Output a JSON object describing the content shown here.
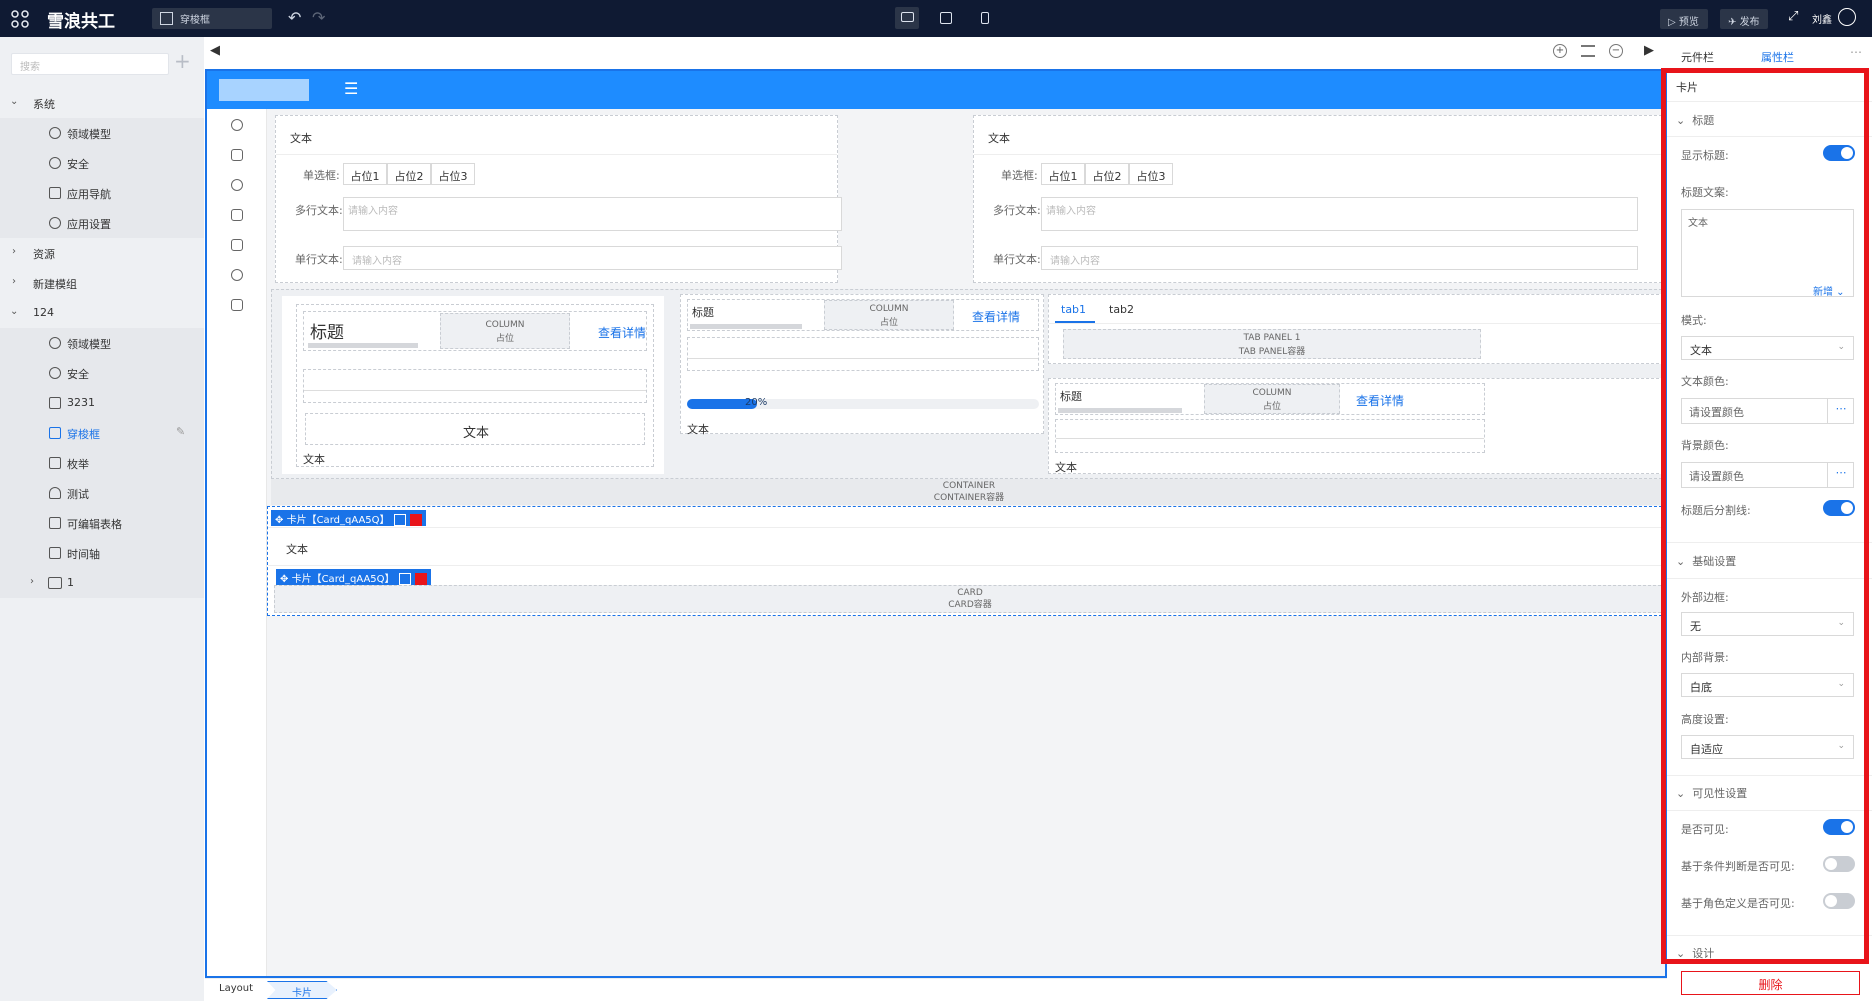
{
  "topbar": {
    "app_title": "雪浪共工",
    "page_selector": "穿梭框",
    "preview_label": "预览",
    "publish_label": "发布",
    "user_name": "刘鑫"
  },
  "sidebar": {
    "search_placeholder": "搜索",
    "groups": {
      "system": "系统",
      "system_domain": "领域模型",
      "system_security": "安全",
      "system_nav": "应用导航",
      "system_settings": "应用设置",
      "resources": "资源",
      "new_module": "新建模组",
      "g124": "124",
      "g124_domain": "领域模型",
      "g124_security": "安全",
      "g124_3231": "3231",
      "g124_shuttle": "穿梭框",
      "g124_enum": "枚举",
      "g124_test": "测试",
      "g124_table": "可编辑表格",
      "g124_timeline": "时间轴",
      "folder_1": "1"
    }
  },
  "canvas": {
    "form_left": {
      "title": "文本",
      "radio_label": "单选框:",
      "radio_options": [
        "占位1",
        "占位2",
        "占位3"
      ],
      "textarea_label": "多行文本:",
      "textarea_placeholder": "请输入内容",
      "input_label": "单行文本:",
      "input_placeholder": "请输入内容"
    },
    "form_right": {
      "title": "文本",
      "radio_label": "单选框:",
      "radio_options": [
        "占位1",
        "占位2",
        "占位3"
      ],
      "textarea_label": "多行文本:",
      "textarea_placeholder": "请输入内容",
      "input_label": "单行文本:",
      "input_placeholder": "请输入内容"
    },
    "col1": {
      "heading": "标题",
      "column_title": "COLUMN",
      "column_placeholder": "占位",
      "link": "查看详情",
      "inner_text": "文本",
      "footer_text": "文本"
    },
    "col2": {
      "heading": "标题",
      "column_title": "COLUMN",
      "column_placeholder": "占位",
      "link": "查看详情",
      "progress_label": "20%",
      "progress_value": 0.2,
      "footer_text": "文本"
    },
    "col3": {
      "tab1": "tab1",
      "tab2": "tab2",
      "tab_panel_title": "TAB PANEL 1",
      "tab_panel_sub": "TAB PANEL容器",
      "heading": "标题",
      "column_title": "COLUMN",
      "column_placeholder": "占位",
      "link": "查看详情",
      "footer_text": "文本"
    },
    "container_title": "CONTAINER",
    "container_sub": "CONTAINER容器",
    "card_tag": "卡片【Card_qAA5Q】",
    "card_text": "文本",
    "inner_card_tag": "卡片【Card_qAA5Q】",
    "card_title": "CARD",
    "card_sub": "CARD容器"
  },
  "breadcrumb": {
    "root": "Layout",
    "current": "卡片"
  },
  "panel": {
    "tab_components": "元件栏",
    "tab_props": "属性栏",
    "component_name": "卡片",
    "sec_title": "标题",
    "show_title_label": "显示标题:",
    "show_title_on": true,
    "title_copy_label": "标题文案:",
    "title_copy_value": "文本",
    "add_label": "新增",
    "mode_label": "模式:",
    "mode_value": "文本",
    "text_color_label": "文本颜色:",
    "text_color_placeholder": "请设置颜色",
    "bg_color_label": "背景颜色:",
    "bg_color_placeholder": "请设置颜色",
    "title_divider_label": "标题后分割线:",
    "title_divider_on": true,
    "sec_basic": "基础设置",
    "border_label": "外部边框:",
    "border_value": "无",
    "inner_bg_label": "内部背景:",
    "inner_bg_value": "白底",
    "height_label": "高度设置:",
    "height_value": "自适应",
    "sec_visibility": "可见性设置",
    "visible_label": "是否可见:",
    "visible_on": true,
    "cond_visible_label": "基于条件判断是否可见:",
    "cond_visible_on": false,
    "role_visible_label": "基于角色定义是否可见:",
    "role_visible_on": false,
    "sec_design": "设计",
    "delete_label": "删除",
    "highlight_color": "#e8141a",
    "accent_color": "#1a73e8"
  }
}
